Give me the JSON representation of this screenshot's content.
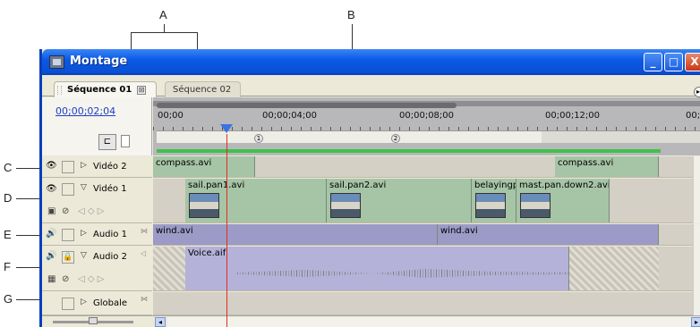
{
  "callouts": {
    "A": "A",
    "B": "B",
    "C": "C",
    "D": "D",
    "E": "E",
    "F": "F",
    "G": "G"
  },
  "window": {
    "title": "Montage",
    "minimize": "_",
    "maximize": "□",
    "close": "X"
  },
  "tabs": [
    {
      "label": "Séquence 01",
      "active": true
    },
    {
      "label": "Séquence 02",
      "active": false
    }
  ],
  "tab_close": "⊠",
  "timecode": "00;00;02;04",
  "ruler": {
    "labels": [
      "00;00",
      "00;00;04;00",
      "00;00;08;00",
      "00;00;12;00",
      "00;"
    ],
    "markers": [
      "1",
      "2"
    ]
  },
  "tracks": {
    "video2": {
      "label": "Vidéo 2",
      "clips": [
        "compass.avi",
        "compass.avi"
      ]
    },
    "video1": {
      "label": "Vidéo 1",
      "clips": [
        "sail.pan1.avi",
        "sail.pan2.avi",
        "belayingp",
        "mast.pan.down2.avi"
      ]
    },
    "audio1": {
      "label": "Audio 1",
      "clips": [
        "wind.avi",
        "wind.avi"
      ]
    },
    "audio2": {
      "label": "Audio 2",
      "clips": [
        "Voice.aif"
      ]
    },
    "master": {
      "label": "Globale"
    }
  },
  "icons": {
    "eye": "👁",
    "speaker": "🔊",
    "lock": "🔒",
    "expand": "▷",
    "collapse": "▽",
    "corner": "⋈",
    "keyframe_nav": "◁ ◇ ▷"
  },
  "colors": {
    "title_bar": "#0a5ae6",
    "video_clip": "#a6c4a6",
    "audio_clip": "#9c9ac6",
    "playhead": "#e03020",
    "work_area": "#3ec24a"
  }
}
